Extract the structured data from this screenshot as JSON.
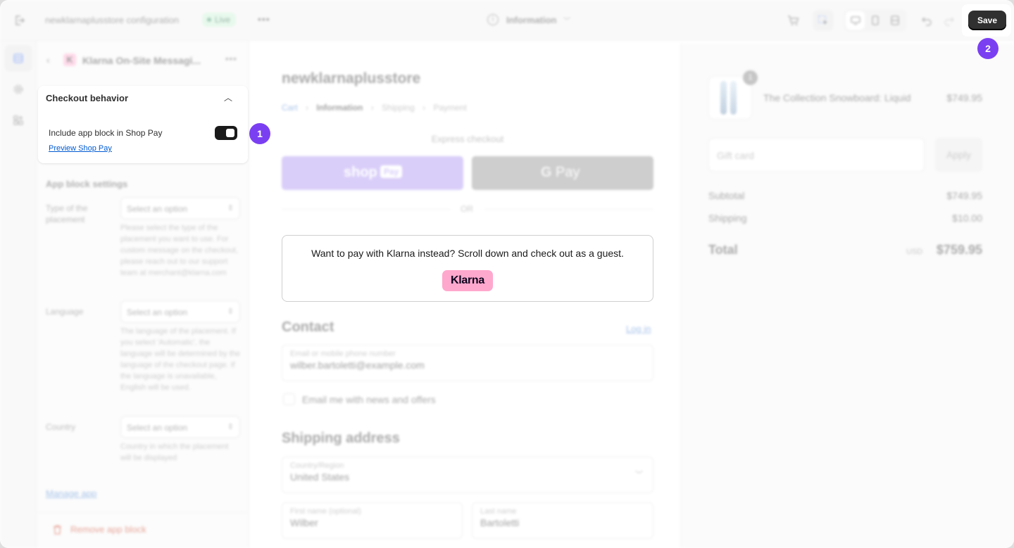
{
  "topbar": {
    "store_config": "newklarnaplusstore configuration",
    "live_badge": "Live",
    "more": "•••",
    "page_selector": "Information",
    "save_label": "Save"
  },
  "sidebar": {
    "app_title": "Klarna On-Site Messagi...",
    "app_logo_letter": "K",
    "more": "•••",
    "checkout_behavior": {
      "title": "Checkout behavior",
      "include_label": "Include app block in Shop Pay",
      "toggle_on": true,
      "preview_link": "Preview Shop Pay"
    },
    "app_block_settings": {
      "title": "App block settings",
      "fields": [
        {
          "label": "Type of the placement",
          "value": "Select an option",
          "help": "Please select the type of the placement you want to use. For custom message on the checkout, please reach out to our support team at merchant@klarna.com"
        },
        {
          "label": "Language",
          "value": "Select an option",
          "help": "The language of the placement. If you select 'Automatic', the language will be determined by the language of the checkout page. If the language is unavailable, English will be used."
        },
        {
          "label": "Country",
          "value": "Select an option",
          "help": "Country in which the placement will be displayed"
        }
      ]
    },
    "manage_app": "Manage app",
    "remove_block": "Remove app block"
  },
  "checkout": {
    "store_name": "newklarnaplusstore",
    "breadcrumbs": [
      "Cart",
      "Information",
      "Shipping",
      "Payment"
    ],
    "express_checkout": "Express checkout",
    "shop_pay_text": "shop",
    "shop_pay_badge": "Pay",
    "gpay_text": "Pay",
    "or": "OR",
    "klarna_message": "Want to pay with Klarna instead? Scroll down and check out as a guest.",
    "klarna_logo": "Klarna",
    "contact_title": "Contact",
    "login_link": "Log in",
    "email_placeholder": "Email or mobile phone number",
    "email_value": "wilber.bartoletti@example.com",
    "email_offers": "Email me with news and offers",
    "shipping_title": "Shipping address",
    "country_label": "Country/Region",
    "country_value": "United States",
    "first_name_label": "First name (optional)",
    "first_name_value": "Wilber",
    "last_name_label": "Last name",
    "last_name_value": "Bartoletti"
  },
  "summary": {
    "item_qty": "1",
    "item_name": "The Collection Snowboard: Liquid",
    "item_price": "$749.95",
    "gift_card_placeholder": "Gift card",
    "apply_label": "Apply",
    "subtotal_label": "Subtotal",
    "subtotal_value": "$749.95",
    "shipping_label": "Shipping",
    "shipping_value": "$10.00",
    "total_label": "Total",
    "currency": "USD",
    "total_value": "$759.95"
  },
  "annotations": {
    "step1": "1",
    "step2": "2"
  },
  "colors": {
    "accent_purple": "#7b3ff2",
    "shop_pay": "#a58bf0",
    "klarna_pink": "#ffa8cd",
    "live_green": "#c7f0d2"
  }
}
